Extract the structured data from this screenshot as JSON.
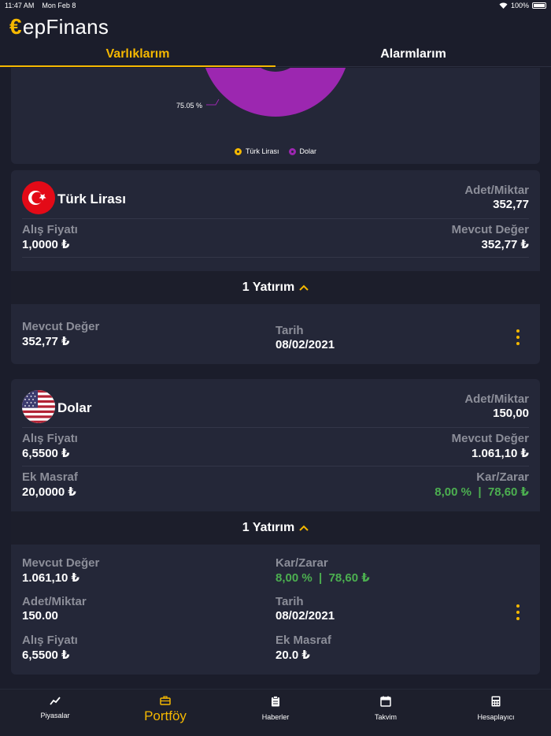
{
  "status_bar": {
    "time": "11:47 AM",
    "date": "Mon Feb 8",
    "battery": "100%"
  },
  "brand": {
    "euro": "€",
    "name": "epFinans"
  },
  "tabs": [
    {
      "label": "Varlıklarım",
      "active": true
    },
    {
      "label": "Alarmlarım",
      "active": false
    }
  ],
  "chart_data": {
    "type": "pie",
    "labels": [
      "Türk Lirası",
      "Dolar"
    ],
    "values": [
      24.95,
      75.05
    ],
    "visible_label": "75.05 %",
    "colors": [
      "#f5b800",
      "#9c27b0"
    ]
  },
  "legend": [
    {
      "label": "Türk Lirası",
      "color": "#f5b800"
    },
    {
      "label": "Dolar",
      "color": "#9c27b0"
    }
  ],
  "assets": [
    {
      "name": "Türk Lirası",
      "adet_label": "Adet/Miktar",
      "adet_value": "352,77",
      "alis_label": "Alış Fiyatı",
      "alis_value": "1,0000 ₺",
      "mevcut_label": "Mevcut Değer",
      "mevcut_value": "352,77 ₺",
      "investments_label": "1 Yatırım",
      "investment": {
        "mevcut_label": "Mevcut Değer",
        "mevcut_value": "352,77 ₺",
        "tarih_label": "Tarih",
        "tarih_value": "08/02/2021"
      }
    },
    {
      "name": "Dolar",
      "adet_label": "Adet/Miktar",
      "adet_value": "150,00",
      "alis_label": "Alış Fiyatı",
      "alis_value": "6,5500 ₺",
      "mevcut_label": "Mevcut Değer",
      "mevcut_value": "1.061,10 ₺",
      "masraf_label": "Ek Masraf",
      "masraf_value": "20,0000 ₺",
      "kar_label": "Kar/Zarar",
      "kar_value": "8,00 %  |  78,60 ₺",
      "investments_label": "1 Yatırım",
      "investment": {
        "mevcut_label": "Mevcut Değer",
        "mevcut_value": "1.061,10 ₺",
        "kar_label": "Kar/Zarar",
        "kar_value": "8,00 %  |  78,60 ₺",
        "adet_label": "Adet/Miktar",
        "adet_value": "150.00",
        "tarih_label": "Tarih",
        "tarih_value": "08/02/2021",
        "alis_label": "Alış Fiyatı",
        "alis_value": "6,5500 ₺",
        "masraf_label": "Ek Masraf",
        "masraf_value": "20.0 ₺"
      }
    }
  ],
  "nav": [
    {
      "label": "Piyasalar",
      "icon": "trend-icon",
      "active": false
    },
    {
      "label": "Portföy",
      "icon": "briefcase-icon",
      "active": true
    },
    {
      "label": "Haberler",
      "icon": "clipboard-icon",
      "active": false
    },
    {
      "label": "Takvim",
      "icon": "calendar-icon",
      "active": false
    },
    {
      "label": "Hesaplayıcı",
      "icon": "calculator-icon",
      "active": false
    }
  ],
  "colors": {
    "accent": "#f5b800",
    "positive": "#4caf50",
    "purple": "#9c27b0"
  }
}
